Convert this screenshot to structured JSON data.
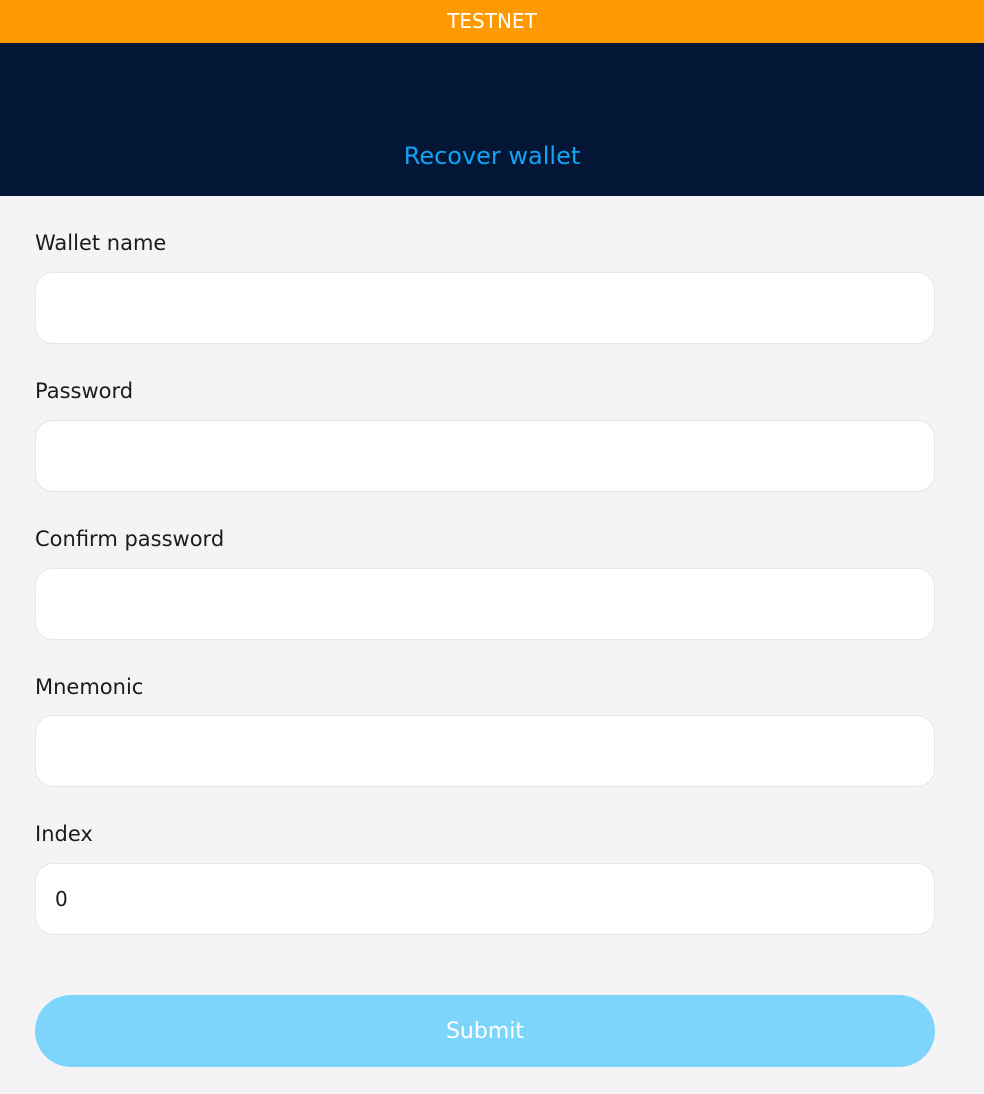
{
  "banner": {
    "label": "TESTNET"
  },
  "header": {
    "title": "Recover wallet"
  },
  "form": {
    "fields": [
      {
        "label": "Wallet name",
        "value": "",
        "type": "text"
      },
      {
        "label": "Password",
        "value": "",
        "type": "password"
      },
      {
        "label": "Confirm password",
        "value": "",
        "type": "password"
      },
      {
        "label": "Mnemonic",
        "value": "",
        "type": "text"
      },
      {
        "label": "Index",
        "value": "0",
        "type": "text"
      }
    ],
    "submit_label": "Submit"
  },
  "colors": {
    "banner": "#fd9a02",
    "header_bg": "#041636",
    "title": "#12a4f4",
    "page_bg": "#f4f4f6",
    "submit_bg": "#7dd5fc"
  }
}
